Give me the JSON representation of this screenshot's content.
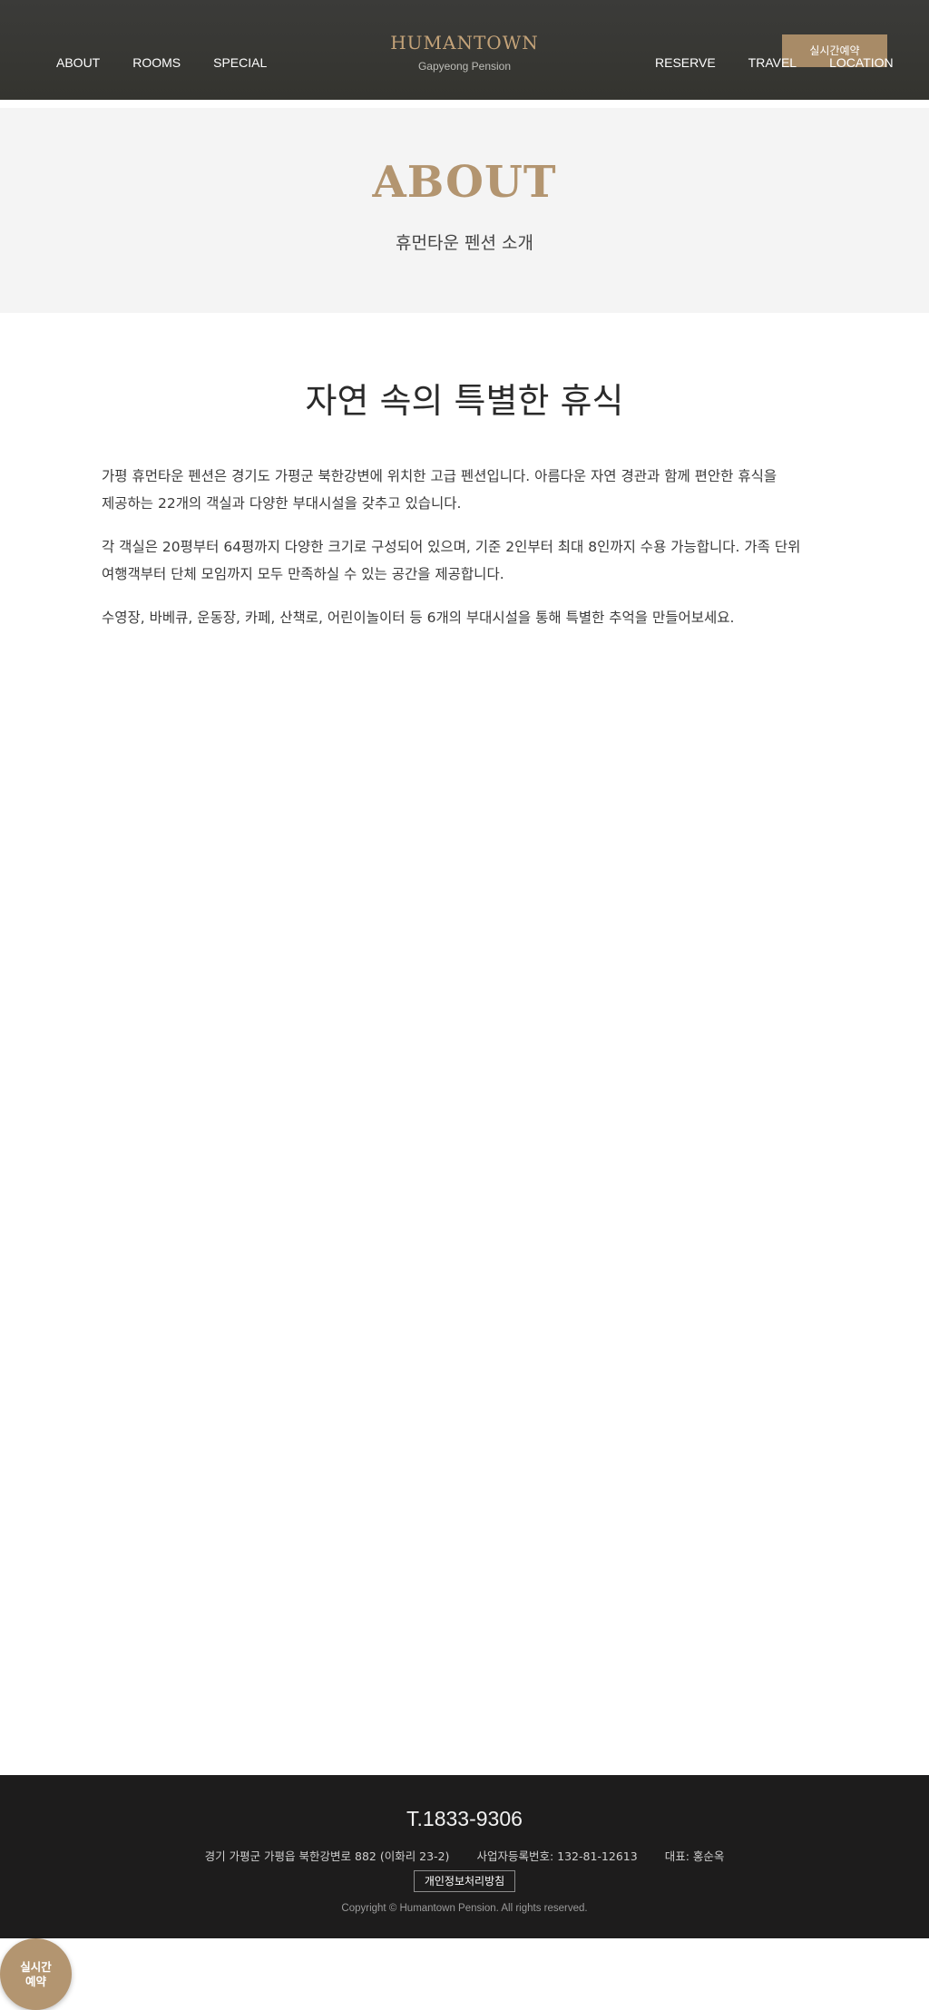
{
  "header": {
    "nav_left": [
      "ABOUT",
      "ROOMS",
      "SPECIAL"
    ],
    "nav_right": [
      "RESERVE",
      "TRAVEL",
      "LOCATION"
    ],
    "logo_title": "HUMANTOWN",
    "logo_subtitle": "Gapyeong Pension",
    "reserve_button": "실시간예약"
  },
  "hero": {
    "title": "ABOUT",
    "subtitle": "휴먼타운 펜션 소개"
  },
  "content": {
    "heading": "자연 속의 특별한 휴식",
    "paragraphs": [
      "가평 휴먼타운 펜션은 경기도 가평군 북한강변에 위치한 고급 펜션입니다. 아름다운 자연 경관과 함께 편안한 휴식을 제공하는 22개의 객실과 다양한 부대시설을 갖추고 있습니다.",
      "각 객실은 20평부터 64평까지 다양한 크기로 구성되어 있으며, 기준 2인부터 최대 8인까지 수용 가능합니다. 가족 단위 여행객부터 단체 모임까지 모두 만족하실 수 있는 공간을 제공합니다.",
      "수영장, 바베큐, 운동장, 카페, 산책로, 어린이놀이터 등 6개의 부대시설을 통해 특별한 추억을 만들어보세요."
    ]
  },
  "footer": {
    "phone": "T.1833-9306",
    "address": "경기 가평군 가평읍 북한강변로 882 (이화리 23-2)",
    "business_number": "사업자등록번호: 132-81-12613",
    "representative": "대표: 홍순옥",
    "privacy_link": "개인정보처리방침",
    "copyright": "Copyright © Humantown Pension. All rights reserved."
  },
  "floating_button": {
    "line1": "실시간",
    "line2": "예약"
  },
  "colors": {
    "header_bg": "#383836",
    "accent_gold": "#b39570",
    "hero_bg": "#f4f4f4",
    "footer_bg": "#1d1c1c"
  }
}
